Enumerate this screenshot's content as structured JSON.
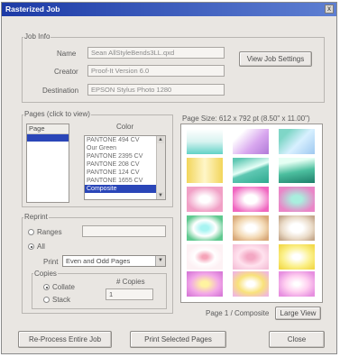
{
  "window": {
    "title": "Rasterized Job",
    "close_glyph": "x"
  },
  "job_info": {
    "group_label": "Job Info",
    "name_label": "Name",
    "name_value": "Sean AllStyleBends3LL.qxd",
    "creator_label": "Creator",
    "creator_value": "Proof-It Version 6.0",
    "destination_label": "Destination",
    "destination_value": "EPSON Stylus Photo 1280",
    "view_settings_button": "View Job Settings"
  },
  "pages": {
    "group_label": "Pages (click to view)",
    "list_header": "Page",
    "items": [
      ""
    ],
    "color_label": "Color",
    "color_items": [
      "PANTONE 494 CV",
      "Our Green",
      "PANTONE 2395 CV",
      "PANTONE 208 CV",
      "PANTONE 124 CV",
      "PANTONE 1655 CV",
      "Composite"
    ],
    "color_selected": 6
  },
  "reprint": {
    "group_label": "Reprint",
    "ranges_label": "Ranges",
    "all_label": "All",
    "print_label": "Print",
    "print_value": "Even and Odd Pages",
    "copies_label": "Copies",
    "collate_label": "Collate",
    "stack_label": "Stack",
    "num_copies_label": "# Copies",
    "num_copies_value": "1",
    "selected": "all",
    "copy_mode": "collate"
  },
  "preview": {
    "page_size_label": "Page Size: 612 x 792 pt (8.50\" x 11.00\")",
    "caption": "Page 1 / Composite",
    "large_view_button": "Large View"
  },
  "footer": {
    "reprocess_button": "Re-Process Entire Job",
    "print_selected_button": "Print Selected Pages",
    "close_button": "Close"
  }
}
